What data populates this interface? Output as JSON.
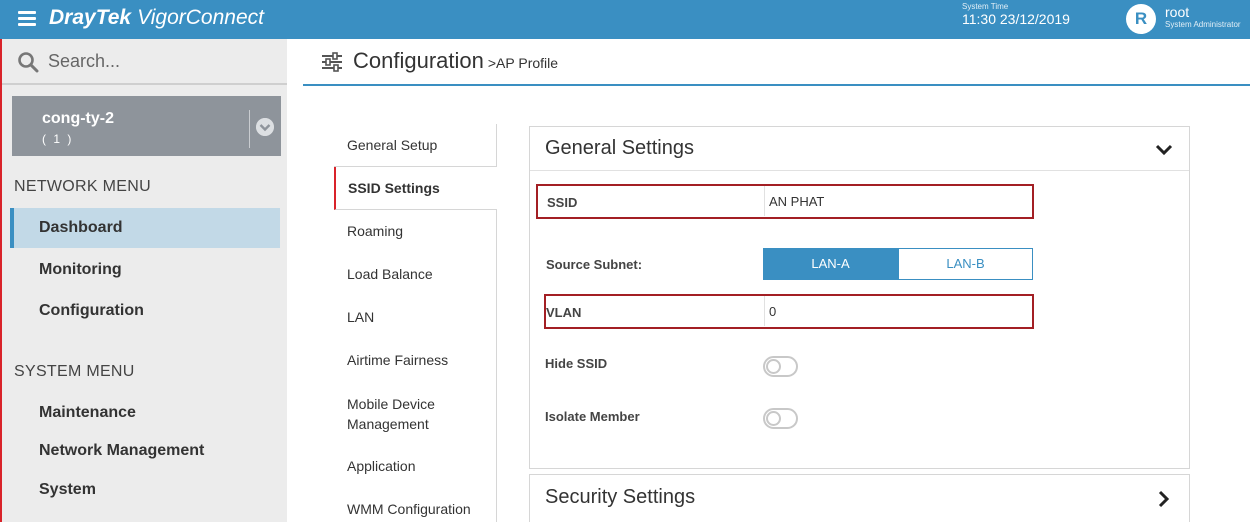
{
  "topbar": {
    "brand_main": "DrayTek",
    "brand_product": "VigorConnect",
    "system_time_label": "System Time",
    "system_time": "11:30 23/12/2019",
    "avatar_letter": "R",
    "user_name": "root",
    "user_role": "System Administrator"
  },
  "sidebar": {
    "search_placeholder": "Search...",
    "site_name": "cong-ty-2",
    "site_count": "( 1 )",
    "network_menu": {
      "heading": "NETWORK MENU",
      "items": [
        "Dashboard",
        "Monitoring",
        "Configuration"
      ]
    },
    "system_menu": {
      "heading": "SYSTEM MENU",
      "items": [
        "Maintenance",
        "Network Management",
        "System"
      ]
    }
  },
  "header": {
    "title": "Configuration",
    "breadcrumb": ">AP Profile"
  },
  "tabs": [
    "General Setup",
    "SSID Settings",
    "Roaming",
    "Load Balance",
    "LAN",
    "Airtime Fairness",
    "Mobile Device Management",
    "Application",
    "WMM Configuration"
  ],
  "active_tab": "SSID Settings",
  "general_settings": {
    "title": "General Settings",
    "ssid_label": "SSID",
    "ssid_value": "AN PHAT",
    "source_subnet_label": "Source Subnet:",
    "subnet_options": [
      "LAN-A",
      "LAN-B"
    ],
    "subnet_selected": "LAN-A",
    "vlan_label": "VLAN",
    "vlan_value": "0",
    "hide_ssid_label": "Hide SSID",
    "hide_ssid": false,
    "isolate_member_label": "Isolate Member",
    "isolate_member": false
  },
  "security_settings": {
    "title": "Security Settings"
  },
  "colors": {
    "accent": "#3a8fc2",
    "highlight_border": "#a31f24",
    "active_menu_bg": "#c2d9e7",
    "sidebar_bg": "#ececec"
  }
}
